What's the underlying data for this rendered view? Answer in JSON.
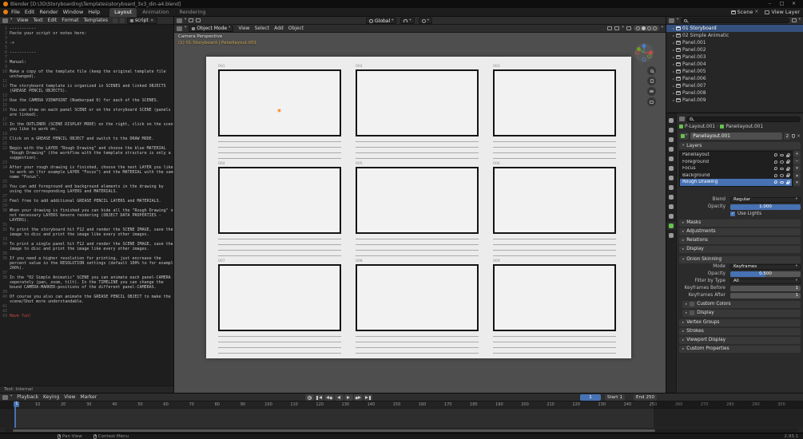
{
  "glyphs": {
    "caret_down": "▾",
    "caret_right": "▸",
    "close": "×",
    "check": "✓",
    "crumb_sep": "›"
  },
  "titlebar": {
    "title": "Blender [D:\\3D\\Storyboarding\\Templates\\storyboard_3x3_din-a4.blend]",
    "minimize": "–",
    "maximize": "□",
    "close": "×"
  },
  "topbar": {
    "menus": [
      "File",
      "Edit",
      "Render",
      "Window",
      "Help"
    ],
    "workspaces": [
      {
        "label": "Layout",
        "active": true
      },
      {
        "label": "Animation"
      },
      {
        "label": "Rendering"
      }
    ],
    "scene_label": "Scene",
    "view_layer_label": "View Layer"
  },
  "text_editor": {
    "menus": [
      "View",
      "Text",
      "Edit",
      "Format",
      "Templates"
    ],
    "datablock": "script",
    "footer": "Text: Internal",
    "lines": [
      {
        "n": "1",
        "t": "-----------"
      },
      {
        "n": "2",
        "t": "Paste your script or notes here:"
      },
      {
        "n": "3",
        "t": ""
      },
      {
        "n": "4",
        "t": "->"
      },
      {
        "n": "5",
        "t": ""
      },
      {
        "n": "6",
        "t": "-----------"
      },
      {
        "n": "7",
        "t": ""
      },
      {
        "n": "8",
        "t": "Manual:"
      },
      {
        "n": "9",
        "t": ""
      },
      {
        "n": "10",
        "t": "Make a copy of the template file (keep the original template file"
      },
      {
        "n": "",
        "t": "unchanged)."
      },
      {
        "n": "11",
        "t": ""
      },
      {
        "n": "12",
        "t": "The storyboard template is organized in SCENES and linked OBJECTS"
      },
      {
        "n": "",
        "t": "(GREASE PENCIL OBJECTS)."
      },
      {
        "n": "13",
        "t": ""
      },
      {
        "n": "14",
        "t": "Use the CAMERA VIEWPOINT (Numberpad 0) for each of the SCENES."
      },
      {
        "n": "15",
        "t": ""
      },
      {
        "n": "16",
        "t": "You can draw on each panel SCENE or on the storyboard SCENE (panels"
      },
      {
        "n": "",
        "t": "are linked)."
      },
      {
        "n": "17",
        "t": ""
      },
      {
        "n": "18",
        "t": "In the OUTLINER (SCENE DISPLAY MODE) on the right, click on the scene"
      },
      {
        "n": "",
        "t": "you like to work on."
      },
      {
        "n": "19",
        "t": ""
      },
      {
        "n": "20",
        "t": "Click on a GREASE PENCIL OBJECT and switch to the DRAW MODE."
      },
      {
        "n": "21",
        "t": ""
      },
      {
        "n": "22",
        "t": "Begin with the LAYER \"Rough Drawing\" and choose the blue MATERIAL"
      },
      {
        "n": "",
        "t": "\"Rough Drawing\" (the workflow with the template structure is only a"
      },
      {
        "n": "",
        "t": "suggestion)."
      },
      {
        "n": "23",
        "t": ""
      },
      {
        "n": "24",
        "t": "After your rough drawing is finished, choose the next LAYER you like"
      },
      {
        "n": "",
        "t": "to work on (for example LAYER \"Focus\") and the MATERIAL with the same"
      },
      {
        "n": "",
        "t": "name \"Focus\"."
      },
      {
        "n": "25",
        "t": ""
      },
      {
        "n": "26",
        "t": "You can add foreground and background elements in the drawing by"
      },
      {
        "n": "",
        "t": "using the corresponding LAYERS and MATERIALS."
      },
      {
        "n": "27",
        "t": ""
      },
      {
        "n": "28",
        "t": "Feel free to add additional GREASE PENCIL LAYERS and MATERIALS."
      },
      {
        "n": "29",
        "t": ""
      },
      {
        "n": "30",
        "t": "When your drawing is finished you can hide all the \"Rough Drawing\" or"
      },
      {
        "n": "",
        "t": "not necessary LAYERS bevore rendering (OBJECT DATA PROPERTIES -"
      },
      {
        "n": "",
        "t": "LAYERS)."
      },
      {
        "n": "31",
        "t": ""
      },
      {
        "n": "32",
        "t": "To print the storyboard hit F12 and render the SCENE IMAGE, save the"
      },
      {
        "n": "",
        "t": "image to disc and print the image like every other images."
      },
      {
        "n": "33",
        "t": ""
      },
      {
        "n": "34",
        "t": "To print a single panel hit F12 and render the SCENE IMAGE, save the"
      },
      {
        "n": "",
        "t": "image to disc and print the image like every other images."
      },
      {
        "n": "35",
        "t": ""
      },
      {
        "n": "36",
        "t": "If you need a higher resolution for printing, just encrease the"
      },
      {
        "n": "",
        "t": "percent value in the RESOLUTION settings (default 100% to for example"
      },
      {
        "n": "",
        "t": "200%)."
      },
      {
        "n": "37",
        "t": ""
      },
      {
        "n": "38",
        "t": "In the \"02 Simple Animatic\" SCENE you can animate each panel-CAMERA"
      },
      {
        "n": "",
        "t": "seperately (pan, zoom, tilt). In the TIMELINE you can change the"
      },
      {
        "n": "",
        "t": "bound CAMERA-MARKER-positions of the different panel-CAMERAS."
      },
      {
        "n": "39",
        "t": ""
      },
      {
        "n": "40",
        "t": "Of course you also can animate the GREASE PENCIL OBJECT to make the"
      },
      {
        "n": "",
        "t": "scene/Shot more understandable."
      },
      {
        "n": "41",
        "t": ""
      },
      {
        "n": "42",
        "t": ""
      },
      {
        "n": "43",
        "t": "Have fun!",
        "red": true
      }
    ]
  },
  "viewport": {
    "mode": "Object Mode",
    "menus": [
      "View",
      "Select",
      "Add",
      "Object"
    ],
    "orientation": "Global",
    "overlay": {
      "line1": "Camera Perspective",
      "line2": "(1) 01 Storyboard | Panellayout.001"
    },
    "panels": [
      {
        "label": "001"
      },
      {
        "label": "002"
      },
      {
        "label": "003"
      },
      {
        "label": "004"
      },
      {
        "label": "005"
      },
      {
        "label": "006"
      },
      {
        "label": "007"
      },
      {
        "label": "008"
      },
      {
        "label": "009"
      }
    ]
  },
  "outliner": {
    "rows": [
      {
        "label": "01 Storyboard",
        "selected": true
      },
      {
        "label": "02 Simple Animatic"
      },
      {
        "label": "Panel.001"
      },
      {
        "label": "Panel.002"
      },
      {
        "label": "Panel.003"
      },
      {
        "label": "Panel.004"
      },
      {
        "label": "Panel.005"
      },
      {
        "label": "Panel.006"
      },
      {
        "label": "Panel.007"
      },
      {
        "label": "Panel.008"
      },
      {
        "label": "Panel.009"
      }
    ]
  },
  "properties": {
    "tabs": [
      {
        "icon": "tab-tool-icon"
      },
      {
        "icon": "tab-render-icon"
      },
      {
        "icon": "tab-output-icon"
      },
      {
        "icon": "tab-view-layer-icon"
      },
      {
        "icon": "tab-scene-icon"
      },
      {
        "icon": "tab-world-icon"
      },
      {
        "icon": "tab-object-icon"
      },
      {
        "icon": "tab-modifiers-icon"
      },
      {
        "icon": "tab-particles-icon"
      },
      {
        "icon": "tab-physics-icon"
      },
      {
        "icon": "tab-constraints-icon"
      },
      {
        "icon": "tab-object-data-icon",
        "active": true
      },
      {
        "icon": "tab-material-icon"
      }
    ],
    "breadcrumb": [
      "P-Layout.001",
      "Panellayout.001"
    ],
    "datablock": {
      "name": "Panellayout.001",
      "users": "2"
    },
    "layers_title": "Layers",
    "layers": [
      {
        "name": "Panellayout"
      },
      {
        "name": "Foreground"
      },
      {
        "name": "Focus"
      },
      {
        "name": "Background"
      },
      {
        "name": "Rough Drawing",
        "selected": true
      }
    ],
    "list_buttons": [
      "+",
      "−",
      "▾",
      "▴",
      "▾"
    ],
    "blend": {
      "label": "Blend",
      "value": "Regular"
    },
    "opacity": {
      "label": "Opacity",
      "value": "1.000",
      "fill": 100
    },
    "use_lights": {
      "label": "Use Lights",
      "checked": true
    },
    "layer_panels": [
      "Masks",
      "Adjustments",
      "Relations",
      "Display"
    ],
    "onion": {
      "title": "Onion Skinning",
      "mode_label": "Mode",
      "mode": "Keyframes",
      "opacity_label": "Opacity",
      "opacity": "0.500",
      "fill": 50,
      "filter_label": "Filter by Type",
      "filter": "All",
      "before_label": "Keyframes Before",
      "before": "1",
      "after_label": "Keyframes After",
      "after": "1",
      "sub": [
        {
          "label": "Custom Colors",
          "checkbox": true
        },
        {
          "label": "Display"
        }
      ]
    },
    "bottom_panels": [
      "Vertex Groups",
      "Strokes",
      "Viewport Display",
      "Custom Properties"
    ]
  },
  "timeline": {
    "menus": [
      "Playback",
      "Keying",
      "View",
      "Marker"
    ],
    "current_frame": "1",
    "start_label": "Start",
    "start": "1",
    "end_label": "End",
    "end": "250",
    "ticks": [
      10,
      20,
      30,
      40,
      50,
      60,
      70,
      80,
      90,
      100,
      110,
      120,
      130,
      140,
      150,
      160,
      170,
      180,
      190,
      200,
      210,
      220,
      230,
      240,
      250,
      260,
      270,
      280,
      290,
      300
    ]
  },
  "statusbar": {
    "hints": [
      {
        "label": "Pan View"
      },
      {
        "label": "Context Menu"
      }
    ],
    "version": "2.93.1"
  }
}
